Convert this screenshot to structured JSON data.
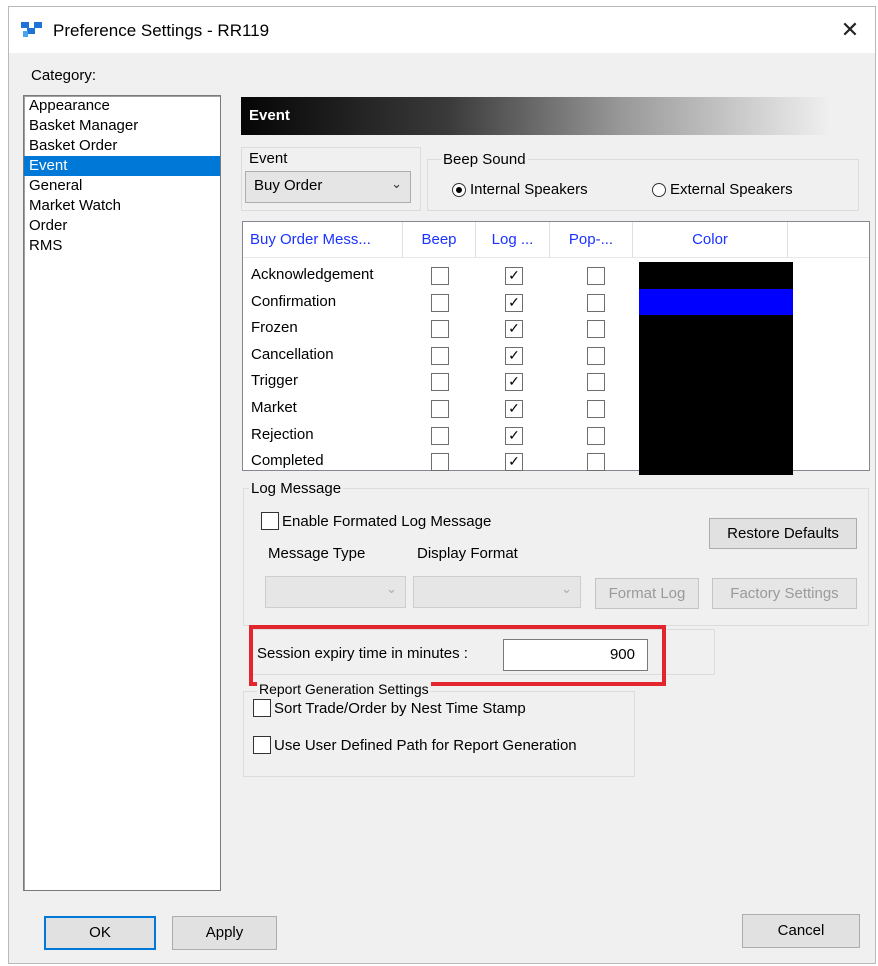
{
  "window": {
    "title": "Preference Settings - RR119",
    "close_glyph": "✕"
  },
  "category": {
    "label": "Category:",
    "items": [
      "Appearance",
      "Basket Manager",
      "Basket Order",
      "Event",
      "General",
      "Market Watch",
      "Order",
      "RMS"
    ],
    "selected": "Event"
  },
  "panel": {
    "header": "Event"
  },
  "event_group": {
    "label": "Event",
    "selected": "Buy Order"
  },
  "beep_group": {
    "label": "Beep Sound",
    "options": [
      "Internal Speakers",
      "External Speakers"
    ],
    "selected": "Internal Speakers"
  },
  "table": {
    "columns": [
      "Buy Order Mess...",
      "Beep",
      "Log ...",
      "Pop-...",
      "Color"
    ],
    "rows": [
      {
        "label": "Acknowledgement",
        "beep": false,
        "log": true,
        "popup": false,
        "color": "#000000"
      },
      {
        "label": "Confirmation",
        "beep": false,
        "log": true,
        "popup": false,
        "color": "#0000ff"
      },
      {
        "label": "Frozen",
        "beep": false,
        "log": true,
        "popup": false,
        "color": "#000000"
      },
      {
        "label": "Cancellation",
        "beep": false,
        "log": true,
        "popup": false,
        "color": "#000000"
      },
      {
        "label": "Trigger",
        "beep": false,
        "log": true,
        "popup": false,
        "color": "#000000"
      },
      {
        "label": "Market",
        "beep": false,
        "log": true,
        "popup": false,
        "color": "#000000"
      },
      {
        "label": "Rejection",
        "beep": false,
        "log": true,
        "popup": false,
        "color": "#000000"
      },
      {
        "label": "Completed",
        "beep": false,
        "log": true,
        "popup": false,
        "color": "#000000"
      }
    ],
    "check_glyph": "✓"
  },
  "log_message": {
    "label": "Log Message",
    "enable_label": "Enable Formated Log Message",
    "restore_button": "Restore Defaults",
    "message_type_label": "Message Type",
    "display_format_label": "Display Format",
    "format_log_button": "Format Log",
    "factory_settings_button": "Factory Settings"
  },
  "session": {
    "label": "Session expiry time in minutes :",
    "value": "900",
    "highlight_color": "#e3262d"
  },
  "report": {
    "label": "Report Generation Settings",
    "sort_label": "Sort Trade/Order by  Nest Time Stamp",
    "path_label": "Use User Defined Path for Report Generation"
  },
  "buttons": {
    "ok": "OK",
    "apply": "Apply",
    "cancel": "Cancel"
  },
  "icons": {
    "app": "app-logo-icon",
    "dropdown": "chevron-down-icon"
  }
}
